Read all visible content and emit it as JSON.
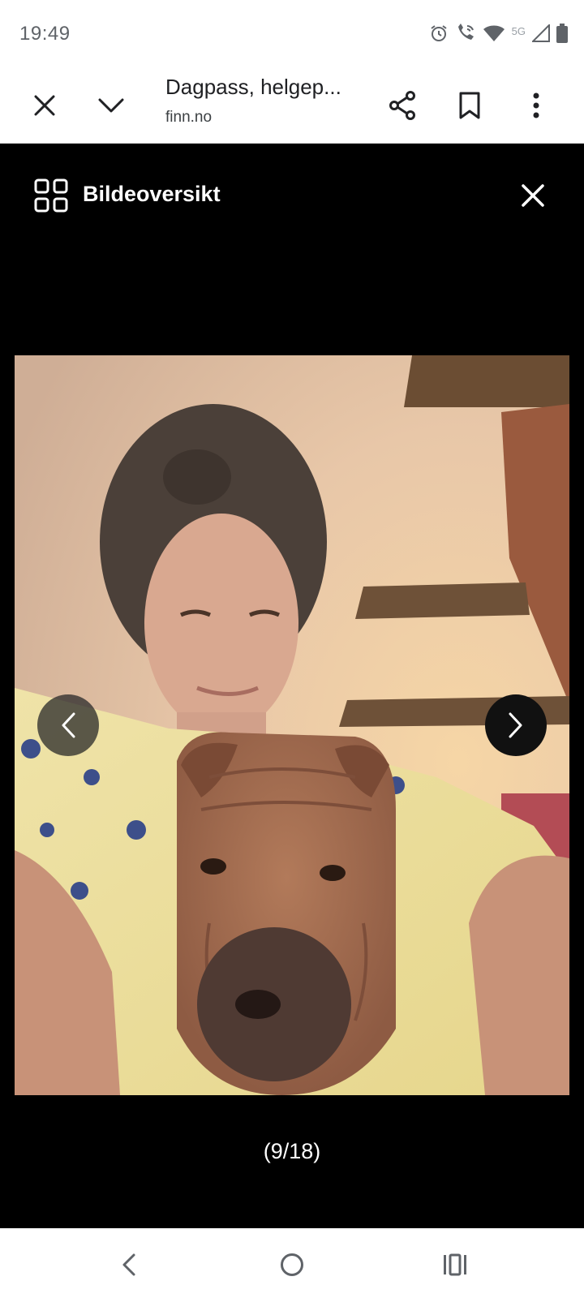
{
  "status_bar": {
    "time": "19:49",
    "icons": [
      "alarm-icon",
      "wifi-call-icon",
      "wifi-icon",
      "5g-icon",
      "signal-icon",
      "battery-icon"
    ],
    "network_label": "5G"
  },
  "toolbar": {
    "title": "Dagpass, helgep...",
    "url": "finn.no",
    "icons": [
      "close-icon",
      "chevron-down-icon",
      "share-icon",
      "bookmark-icon",
      "more-vert-icon"
    ]
  },
  "gallery": {
    "title": "Bildeoversikt",
    "counter": "(9/18)",
    "current_index": 9,
    "total": 18,
    "photo_description": "selfie of a woman with a shar-pei dog",
    "colors": {
      "background": "#000000",
      "text": "#ffffff"
    }
  },
  "navbar": {
    "icons": [
      "back-icon",
      "home-icon",
      "recents-icon"
    ]
  }
}
